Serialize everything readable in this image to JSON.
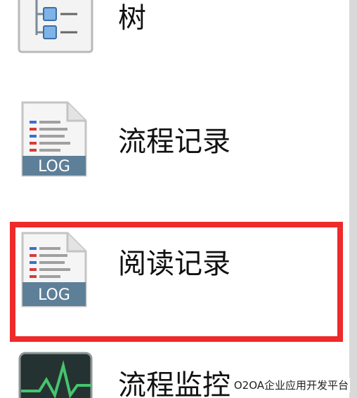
{
  "menu": {
    "items": [
      {
        "label": "树",
        "icon": "tree-icon"
      },
      {
        "label": "流程记录",
        "icon": "log-file-icon",
        "badge": "LOG"
      },
      {
        "label": "阅读记录",
        "icon": "log-file-icon",
        "badge": "LOG",
        "highlighted": true
      },
      {
        "label": "流程监控",
        "icon": "monitor-icon"
      }
    ]
  },
  "watermark": "O2OA企业应用开发平台",
  "colors": {
    "highlight": "#ee2a2a",
    "log_badge": "#5e7f98",
    "monitor_line": "#46c46e"
  }
}
